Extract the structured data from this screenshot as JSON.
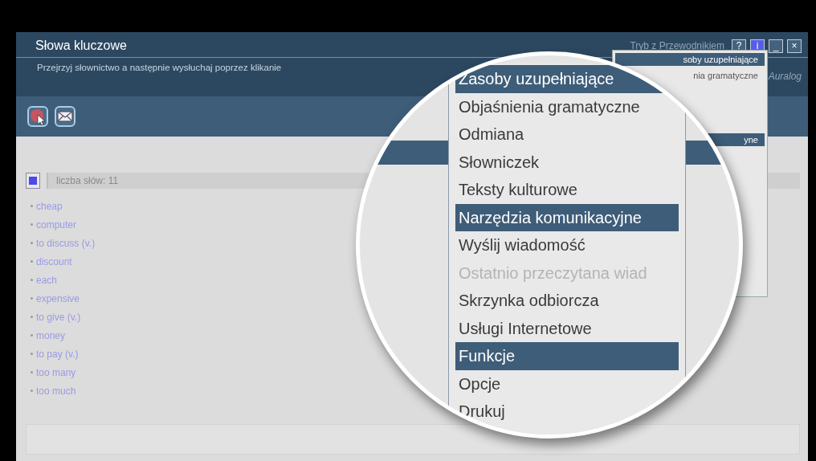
{
  "window": {
    "title": "Słowa kluczowe",
    "subtitle": "Przejrzyj słownictwo a następnie wysłuchaj poprzez klikanie",
    "mode_label": "Tryb z Przewodnikiem",
    "logo": "Auralog",
    "title_buttons": [
      {
        "label": "?",
        "selected": false
      },
      {
        "label": "i",
        "selected": true
      },
      {
        "label": "_",
        "selected": false
      },
      {
        "label": "×",
        "selected": false
      }
    ]
  },
  "word_panel": {
    "checked": true,
    "count": "liczba słów: 11",
    "words": [
      "cheap",
      "computer",
      "to discuss (v.)",
      "discount",
      "each",
      "expensive",
      "to give (v.)",
      "money",
      "to pay (v.)",
      "too many",
      "too much"
    ]
  },
  "small_menu": [
    {
      "label": "soby uzupełniające",
      "kind": "heading"
    },
    {
      "label": "nia gramatyczne",
      "kind": "item"
    },
    {
      "label": "yne",
      "kind": "heading"
    }
  ],
  "magnified_menu": [
    {
      "label": "Zasoby uzupełniające",
      "kind": "heading",
      "disabled": false
    },
    {
      "label": "Objaśnienia gramatyczne",
      "kind": "item",
      "disabled": false
    },
    {
      "label": "Odmiana",
      "kind": "item",
      "disabled": false
    },
    {
      "label": "Słowniczek",
      "kind": "item",
      "disabled": false
    },
    {
      "label": "Teksty kulturowe",
      "kind": "item",
      "disabled": false
    },
    {
      "label": "Narzędzia komunikacyjne",
      "kind": "heading",
      "disabled": false
    },
    {
      "label": "Wyślij wiadomość",
      "kind": "item",
      "disabled": false
    },
    {
      "label": "Ostatnio przeczytana wiad",
      "kind": "item",
      "disabled": true
    },
    {
      "label": "Skrzynka odbiorcza",
      "kind": "item",
      "disabled": false
    },
    {
      "label": "Usługi Internetowe",
      "kind": "item",
      "disabled": false
    },
    {
      "label": "Funkcje",
      "kind": "heading",
      "disabled": false
    },
    {
      "label": "Opcje",
      "kind": "item",
      "disabled": false
    },
    {
      "label": "Drukuj",
      "kind": "item",
      "disabled": false
    }
  ]
}
